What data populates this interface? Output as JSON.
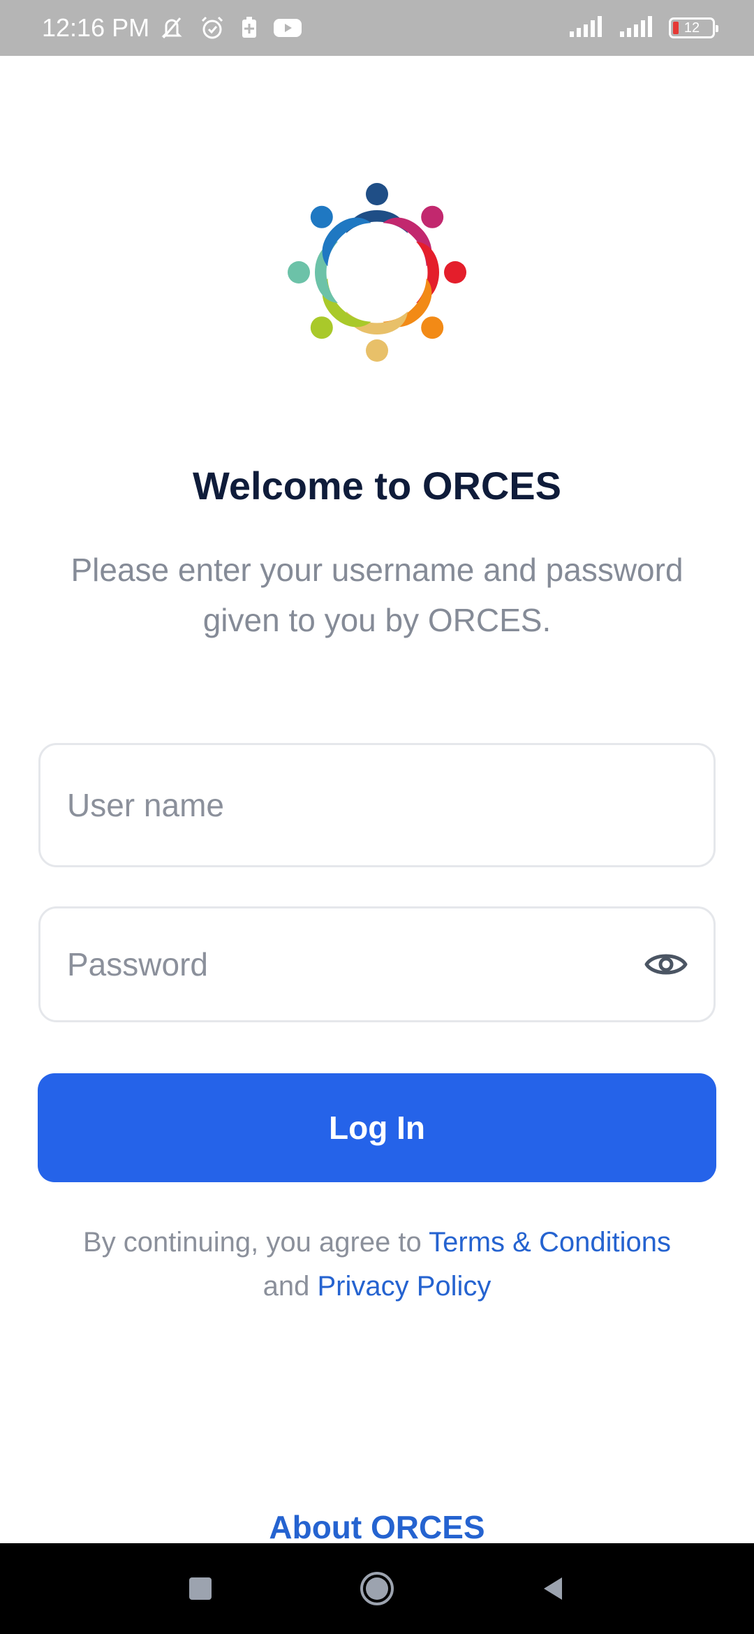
{
  "status_bar": {
    "time": "12:16 PM",
    "battery_level": "12"
  },
  "login": {
    "title": "Welcome to ORCES",
    "subtitle": "Please enter your username and password given to you by ORCES.",
    "username_placeholder": "User name",
    "password_placeholder": "Password",
    "login_label": "Log In",
    "legal_prefix": "By continuing, you agree to ",
    "terms_label": "Terms & Conditions",
    "legal_and": " and ",
    "privacy_label": "Privacy Policy",
    "about_label": "About ORCES"
  },
  "colors": {
    "primary": "#2563e9",
    "link": "#2563d0",
    "title": "#0f1c3a",
    "muted": "#858b97"
  },
  "icons": {
    "logo": "people-circle-logo",
    "password_toggle": "eye-icon",
    "nav_recents": "square-icon",
    "nav_home": "circle-icon",
    "nav_back": "triangle-back-icon"
  }
}
